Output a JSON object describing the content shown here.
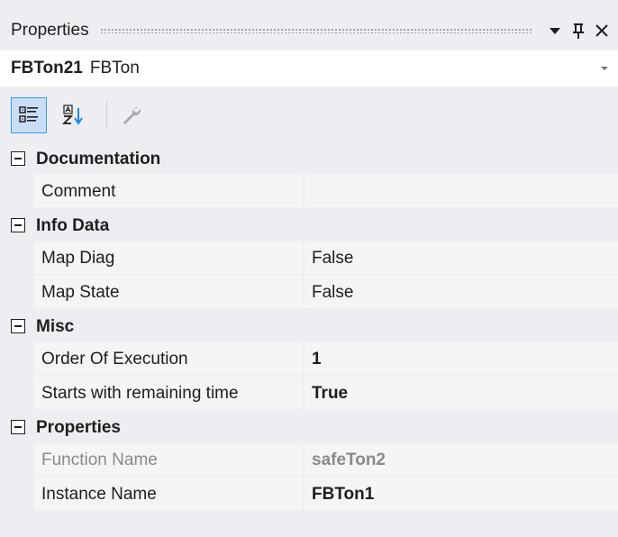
{
  "window": {
    "title": "Properties"
  },
  "titlebar": {
    "dropdown_icon": "dropdown-arrow-icon",
    "pin_icon": "pin-icon",
    "close_icon": "close-icon"
  },
  "selector": {
    "object_name": "FBTon21",
    "object_type": "FBTon"
  },
  "toolbar": {
    "categorized_icon": "categorized-icon",
    "alphabetical_icon": "alphabetical-sort-icon",
    "property_pages_icon": "wrench-icon"
  },
  "grid": {
    "categories": [
      {
        "label": "Documentation",
        "rows": [
          {
            "name": "Comment",
            "value": ""
          }
        ]
      },
      {
        "label": "Info Data",
        "rows": [
          {
            "name": "Map Diag",
            "value": "False"
          },
          {
            "name": "Map State",
            "value": "False"
          }
        ]
      },
      {
        "label": "Misc",
        "rows": [
          {
            "name": "Order Of Execution",
            "value": "1"
          },
          {
            "name": "Starts with remaining time",
            "value": "True"
          }
        ]
      },
      {
        "label": "Properties",
        "rows": [
          {
            "name": "Function Name",
            "value": "safeTon2"
          },
          {
            "name": "Instance Name",
            "value": "FBTon1"
          }
        ]
      }
    ]
  },
  "colors": {
    "panel_bg": "#eeeef2",
    "cell_bg": "#f5f5f5",
    "active_button_bg": "#c9def5",
    "active_button_border": "#3399ff",
    "readonly_text": "#8a8a8a"
  }
}
